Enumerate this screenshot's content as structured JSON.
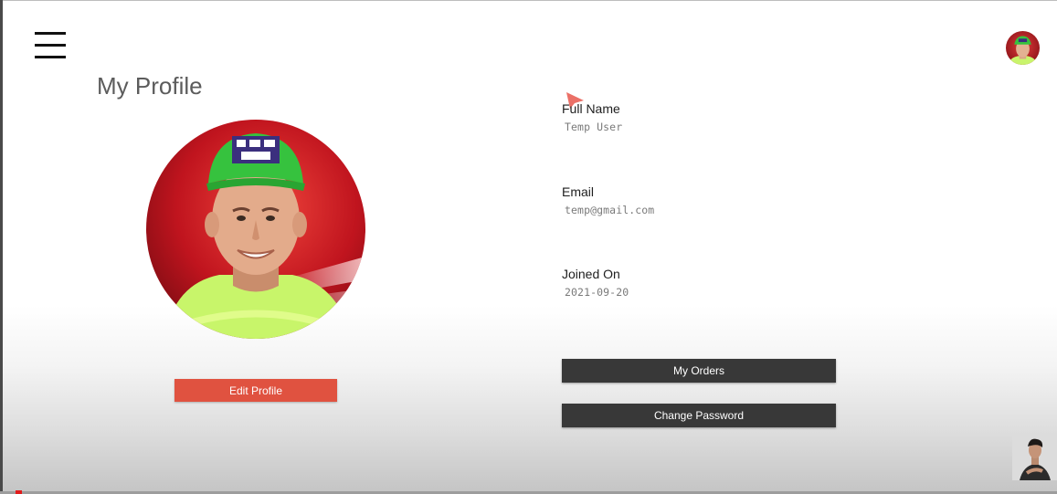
{
  "header": {
    "menu_icon": "hamburger-menu-icon",
    "avatar_icon": "user-avatar"
  },
  "profile": {
    "title": "My Profile",
    "edit_label": "Edit Profile"
  },
  "fields": {
    "full_name_label": "Full Name",
    "full_name_value": "Temp User",
    "email_label": "Email",
    "email_value": "temp@gmail.com",
    "joined_label": "Joined On",
    "joined_value": "2021-09-20"
  },
  "actions": {
    "orders_label": "My Orders",
    "password_label": "Change Password"
  },
  "colors": {
    "edit_button": "#e05240",
    "dark_button": "#383838",
    "photo_background": "#c0141e",
    "cap": "#3dd44a",
    "shirt": "#c8f56a"
  }
}
